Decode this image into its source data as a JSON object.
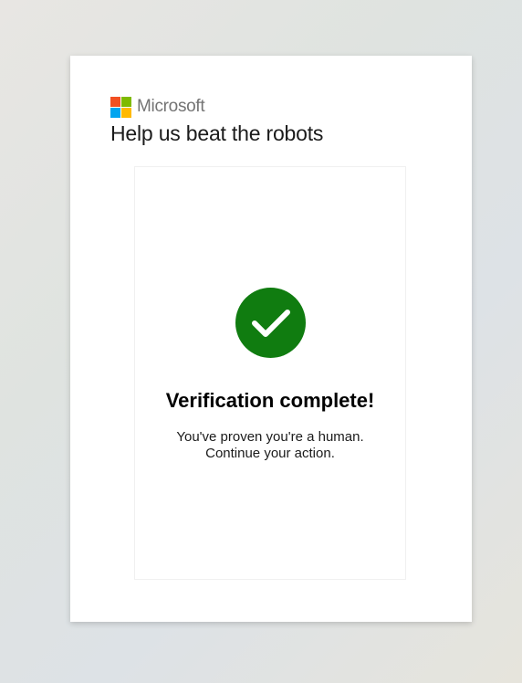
{
  "brand": {
    "name": "Microsoft",
    "logo_colors": [
      "#f25022",
      "#7fba00",
      "#00a4ef",
      "#ffb900"
    ]
  },
  "heading": "Help us beat the robots",
  "result": {
    "icon": "checkmark-icon",
    "status_color": "#107c10",
    "title": "Verification complete!",
    "line1": "You've proven you're a human.",
    "line2": "Continue your action."
  }
}
